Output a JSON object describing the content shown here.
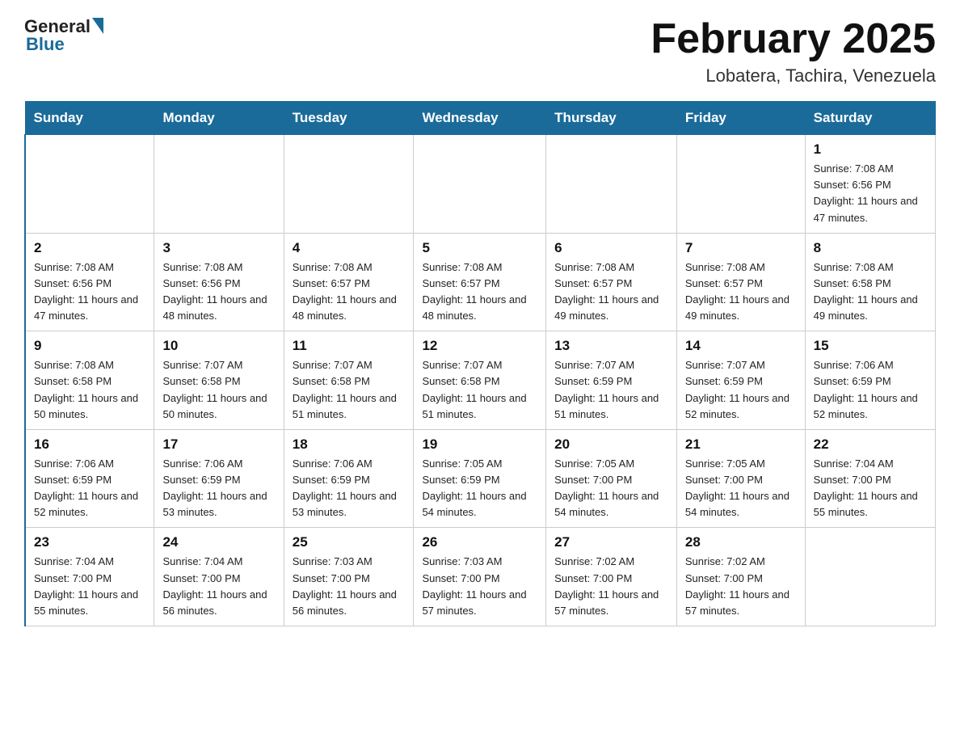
{
  "header": {
    "logo_general": "General",
    "logo_blue": "Blue",
    "title": "February 2025",
    "subtitle": "Lobatera, Tachira, Venezuela"
  },
  "days_of_week": [
    "Sunday",
    "Monday",
    "Tuesday",
    "Wednesday",
    "Thursday",
    "Friday",
    "Saturday"
  ],
  "weeks": [
    [
      {
        "day": "",
        "info": ""
      },
      {
        "day": "",
        "info": ""
      },
      {
        "day": "",
        "info": ""
      },
      {
        "day": "",
        "info": ""
      },
      {
        "day": "",
        "info": ""
      },
      {
        "day": "",
        "info": ""
      },
      {
        "day": "1",
        "info": "Sunrise: 7:08 AM\nSunset: 6:56 PM\nDaylight: 11 hours and 47 minutes."
      }
    ],
    [
      {
        "day": "2",
        "info": "Sunrise: 7:08 AM\nSunset: 6:56 PM\nDaylight: 11 hours and 47 minutes."
      },
      {
        "day": "3",
        "info": "Sunrise: 7:08 AM\nSunset: 6:56 PM\nDaylight: 11 hours and 48 minutes."
      },
      {
        "day": "4",
        "info": "Sunrise: 7:08 AM\nSunset: 6:57 PM\nDaylight: 11 hours and 48 minutes."
      },
      {
        "day": "5",
        "info": "Sunrise: 7:08 AM\nSunset: 6:57 PM\nDaylight: 11 hours and 48 minutes."
      },
      {
        "day": "6",
        "info": "Sunrise: 7:08 AM\nSunset: 6:57 PM\nDaylight: 11 hours and 49 minutes."
      },
      {
        "day": "7",
        "info": "Sunrise: 7:08 AM\nSunset: 6:57 PM\nDaylight: 11 hours and 49 minutes."
      },
      {
        "day": "8",
        "info": "Sunrise: 7:08 AM\nSunset: 6:58 PM\nDaylight: 11 hours and 49 minutes."
      }
    ],
    [
      {
        "day": "9",
        "info": "Sunrise: 7:08 AM\nSunset: 6:58 PM\nDaylight: 11 hours and 50 minutes."
      },
      {
        "day": "10",
        "info": "Sunrise: 7:07 AM\nSunset: 6:58 PM\nDaylight: 11 hours and 50 minutes."
      },
      {
        "day": "11",
        "info": "Sunrise: 7:07 AM\nSunset: 6:58 PM\nDaylight: 11 hours and 51 minutes."
      },
      {
        "day": "12",
        "info": "Sunrise: 7:07 AM\nSunset: 6:58 PM\nDaylight: 11 hours and 51 minutes."
      },
      {
        "day": "13",
        "info": "Sunrise: 7:07 AM\nSunset: 6:59 PM\nDaylight: 11 hours and 51 minutes."
      },
      {
        "day": "14",
        "info": "Sunrise: 7:07 AM\nSunset: 6:59 PM\nDaylight: 11 hours and 52 minutes."
      },
      {
        "day": "15",
        "info": "Sunrise: 7:06 AM\nSunset: 6:59 PM\nDaylight: 11 hours and 52 minutes."
      }
    ],
    [
      {
        "day": "16",
        "info": "Sunrise: 7:06 AM\nSunset: 6:59 PM\nDaylight: 11 hours and 52 minutes."
      },
      {
        "day": "17",
        "info": "Sunrise: 7:06 AM\nSunset: 6:59 PM\nDaylight: 11 hours and 53 minutes."
      },
      {
        "day": "18",
        "info": "Sunrise: 7:06 AM\nSunset: 6:59 PM\nDaylight: 11 hours and 53 minutes."
      },
      {
        "day": "19",
        "info": "Sunrise: 7:05 AM\nSunset: 6:59 PM\nDaylight: 11 hours and 54 minutes."
      },
      {
        "day": "20",
        "info": "Sunrise: 7:05 AM\nSunset: 7:00 PM\nDaylight: 11 hours and 54 minutes."
      },
      {
        "day": "21",
        "info": "Sunrise: 7:05 AM\nSunset: 7:00 PM\nDaylight: 11 hours and 54 minutes."
      },
      {
        "day": "22",
        "info": "Sunrise: 7:04 AM\nSunset: 7:00 PM\nDaylight: 11 hours and 55 minutes."
      }
    ],
    [
      {
        "day": "23",
        "info": "Sunrise: 7:04 AM\nSunset: 7:00 PM\nDaylight: 11 hours and 55 minutes."
      },
      {
        "day": "24",
        "info": "Sunrise: 7:04 AM\nSunset: 7:00 PM\nDaylight: 11 hours and 56 minutes."
      },
      {
        "day": "25",
        "info": "Sunrise: 7:03 AM\nSunset: 7:00 PM\nDaylight: 11 hours and 56 minutes."
      },
      {
        "day": "26",
        "info": "Sunrise: 7:03 AM\nSunset: 7:00 PM\nDaylight: 11 hours and 57 minutes."
      },
      {
        "day": "27",
        "info": "Sunrise: 7:02 AM\nSunset: 7:00 PM\nDaylight: 11 hours and 57 minutes."
      },
      {
        "day": "28",
        "info": "Sunrise: 7:02 AM\nSunset: 7:00 PM\nDaylight: 11 hours and 57 minutes."
      },
      {
        "day": "",
        "info": ""
      }
    ]
  ]
}
